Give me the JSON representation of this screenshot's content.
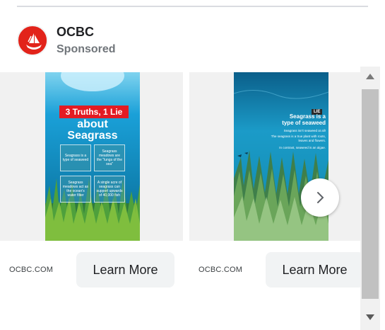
{
  "advertiser": {
    "name": "OCBC",
    "label": "Sponsored",
    "logo_color": "#e2231a"
  },
  "cards": [
    {
      "domain": "OCBC.COM",
      "cta_label": "Learn More",
      "creative": {
        "title_line1": "3 Truths, 1 Lie",
        "title_line2": "about",
        "title_line3": "Seagrass",
        "boxes": [
          "Seagrass is a type of seaweed",
          "Seagrass meadows are the \"lungs of the sea\"",
          "Seagrass meadows act as the ocean's water filter",
          "A single acre of seagrass can support upwards of 40,000 fish"
        ]
      }
    },
    {
      "domain": "OCBC.COM",
      "cta_label": "Learn More",
      "creative": {
        "badge": "LIE",
        "headline_line1": "Seagrass is a",
        "headline_line2": "type of seaweed",
        "sub1": "Seagrass isn't seaweed at all!",
        "sub2": "The seagrass is a true plant with roots, leaves and flowers.",
        "sub3": "In contrast, seaweed is an algae."
      }
    }
  ],
  "icons": {
    "next": "chevron-right-icon",
    "scroll_up": "triangle-up-icon",
    "scroll_down": "triangle-down-icon"
  },
  "colors": {
    "brand_red": "#e31b23",
    "cta_bg": "#f1f3f4",
    "ocean_top": "#1aa0d8",
    "ocean_bottom": "#0c5b7a"
  }
}
